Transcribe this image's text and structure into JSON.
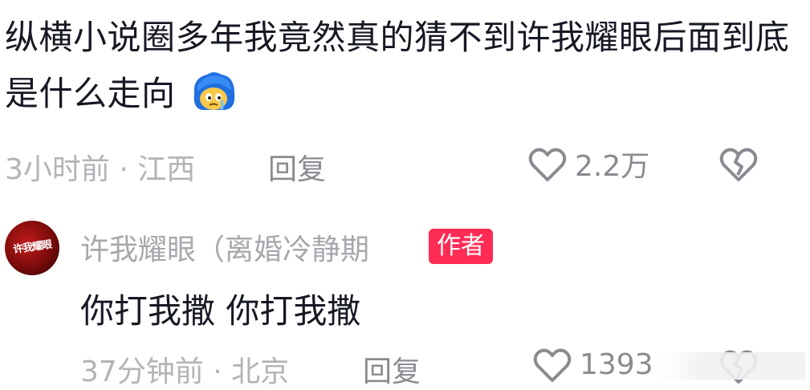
{
  "comment": {
    "text": "纵横小说圈多年我竟然真的猜不到许我耀眼后面到底是什么走向",
    "emoji": "crying-face-emoji",
    "time": "3小时前",
    "location": "江西",
    "reply_label": "回复",
    "likes": "2.2万"
  },
  "reply": {
    "author": "许我耀眼（离婚冷静期",
    "avatar_text": "许我耀眼",
    "badge": "作者",
    "text": "你打我撒 你打我撒",
    "time": "37分钟前",
    "location": "北京",
    "reply_label": "回复",
    "likes": "1393"
  },
  "colors": {
    "accent": "#fe2c55",
    "meta": "#b3b3b8",
    "text": "#161823"
  }
}
